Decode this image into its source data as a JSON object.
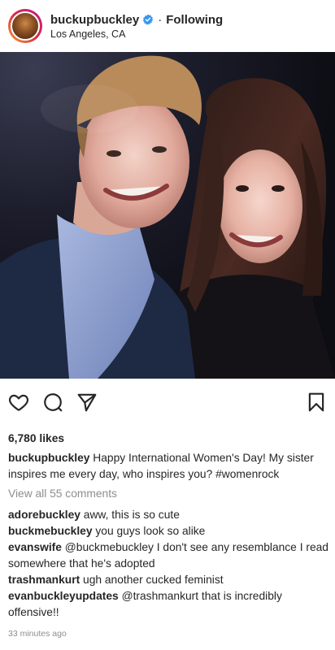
{
  "post": {
    "username": "buckupbuckley",
    "separator": "·",
    "follow_status": "Following",
    "location": "Los Angeles, CA",
    "likes": "6,780 likes",
    "caption_user": "buckupbuckley",
    "caption_text": "Happy International Women's Day! My sister inspires me every day, who inspires you? #womenrock",
    "view_all": "View all 55 comments",
    "time": "33 minutes ago"
  },
  "comments": [
    {
      "user": "adorebuckley",
      "text": "aww, this is so cute"
    },
    {
      "user": "buckmebuckley",
      "text": "you guys look so alike"
    },
    {
      "user": "evanswife",
      "text": "@buckmebuckley I don't see any resemblance I read somewhere that he's adopted"
    },
    {
      "user": "trashmankurt",
      "text": "ugh another cucked feminist"
    },
    {
      "user": "evanbuckleyupdates",
      "text": "@trashmankurt that is incredibly offensive!!"
    }
  ],
  "icons": {
    "like": "heart-icon",
    "comment": "comment-icon",
    "share": "send-icon",
    "save": "bookmark-icon",
    "verified": "verified-badge-icon"
  },
  "colors": {
    "text": "#262626",
    "muted": "#8e8e8e",
    "verified": "#3897f0"
  }
}
